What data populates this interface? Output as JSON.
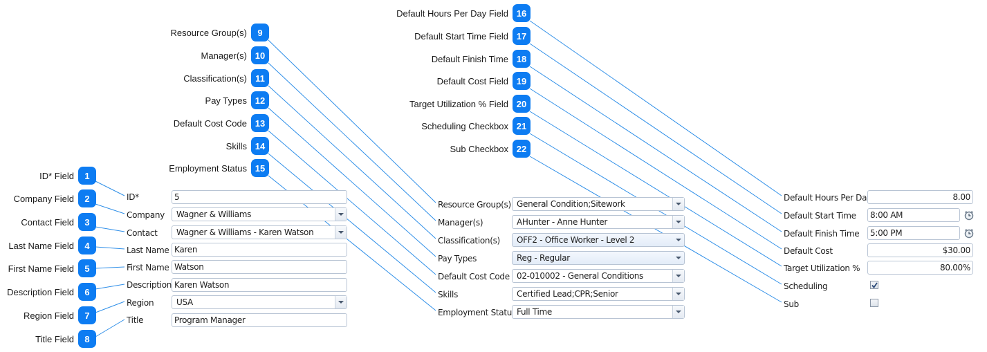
{
  "callouts": [
    {
      "num": "1",
      "text": "ID* Field"
    },
    {
      "num": "2",
      "text": "Company Field"
    },
    {
      "num": "3",
      "text": "Contact Field"
    },
    {
      "num": "4",
      "text": "Last Name Field"
    },
    {
      "num": "5",
      "text": "First Name Field"
    },
    {
      "num": "6",
      "text": "Description Field"
    },
    {
      "num": "7",
      "text": "Region Field"
    },
    {
      "num": "8",
      "text": "Title Field"
    },
    {
      "num": "9",
      "text": "Resource Group(s)"
    },
    {
      "num": "10",
      "text": "Manager(s)"
    },
    {
      "num": "11",
      "text": "Classification(s)"
    },
    {
      "num": "12",
      "text": "Pay Types"
    },
    {
      "num": "13",
      "text": "Default Cost Code"
    },
    {
      "num": "14",
      "text": "Skills"
    },
    {
      "num": "15",
      "text": "Employment Status"
    },
    {
      "num": "16",
      "text": "Default Hours Per Day Field"
    },
    {
      "num": "17",
      "text": "Default Start Time Field"
    },
    {
      "num": "18",
      "text": "Default Finish Time"
    },
    {
      "num": "19",
      "text": "Default Cost Field"
    },
    {
      "num": "20",
      "text": "Target Utilization % Field"
    },
    {
      "num": "21",
      "text": "Scheduling Checkbox"
    },
    {
      "num": "22",
      "text": "Sub Checkbox"
    }
  ],
  "form_left": {
    "id": {
      "label": "ID*",
      "value": "5"
    },
    "company": {
      "label": "Company",
      "value": "Wagner & Williams"
    },
    "contact": {
      "label": "Contact",
      "value": "Wagner & Williams - Karen Watson"
    },
    "last_name": {
      "label": "Last Name",
      "value": "Karen"
    },
    "first_name": {
      "label": "First Name",
      "value": "Watson"
    },
    "description": {
      "label": "Description",
      "value": "Karen Watson"
    },
    "region": {
      "label": "Region",
      "value": "USA"
    },
    "title": {
      "label": "Title",
      "value": "Program Manager"
    }
  },
  "form_middle": {
    "resource_groups": {
      "label": "Resource Group(s)",
      "value": "General Condition;Sitework"
    },
    "managers": {
      "label": "Manager(s)",
      "value": "AHunter - Anne Hunter"
    },
    "classifications": {
      "label": "Classification(s)",
      "value": "OFF2 - Office Worker - Level 2"
    },
    "pay_types": {
      "label": "Pay Types",
      "value": "Reg - Regular"
    },
    "default_cost_code": {
      "label": "Default Cost Code",
      "value": "02-010002 - General Conditions"
    },
    "skills": {
      "label": "Skills",
      "value": "Certified Lead;CPR;Senior"
    },
    "employment_status": {
      "label": "Employment Status",
      "value": "Full Time"
    }
  },
  "form_right": {
    "default_hours_per_day": {
      "label": "Default Hours Per Day",
      "value": "8.00"
    },
    "default_start_time": {
      "label": "Default Start Time",
      "value": "8:00 AM"
    },
    "default_finish_time": {
      "label": "Default Finish Time",
      "value": "5:00 PM"
    },
    "default_cost": {
      "label": "Default Cost",
      "value": "$30.00"
    },
    "target_utilization": {
      "label": "Target Utilization %",
      "value": "80.00%"
    },
    "scheduling": {
      "label": "Scheduling",
      "checked": true
    },
    "sub": {
      "label": "Sub",
      "checked": false
    }
  },
  "colors": {
    "badge": "#0d7cf2",
    "connector": "#2f8fe8"
  }
}
